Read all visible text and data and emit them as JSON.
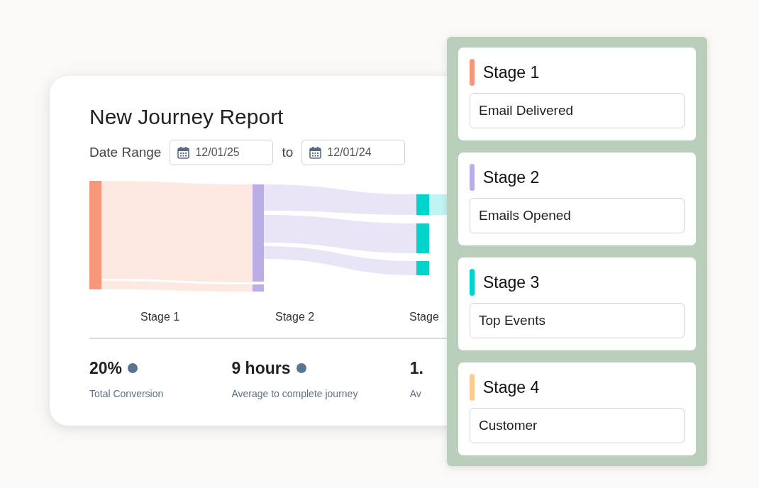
{
  "report": {
    "title": "New Journey Report",
    "date_range_label": "Date Range",
    "from_date": "12/01/25",
    "to_label": "to",
    "to_date": "12/01/24",
    "sankey_labels": [
      "Stage 1",
      "Stage 2",
      "Stage"
    ],
    "metrics": [
      {
        "value": "20%",
        "caption": "Total Conversion",
        "dot": true
      },
      {
        "value": "9 hours",
        "caption": "Average to complete journey",
        "dot": true
      },
      {
        "value": "1.",
        "caption": "Av",
        "dot": false
      }
    ]
  },
  "stages": [
    {
      "title": "Stage 1",
      "color": "#f7977a",
      "field": "Email Delivered"
    },
    {
      "title": "Stage 2",
      "color": "#bbaee6",
      "field": "Emails Opened"
    },
    {
      "title": "Stage 3",
      "color": "#00d4cc",
      "field": "Top Events"
    },
    {
      "title": "Stage 4",
      "color": "#f8cc95",
      "field": "Customer"
    }
  ]
}
